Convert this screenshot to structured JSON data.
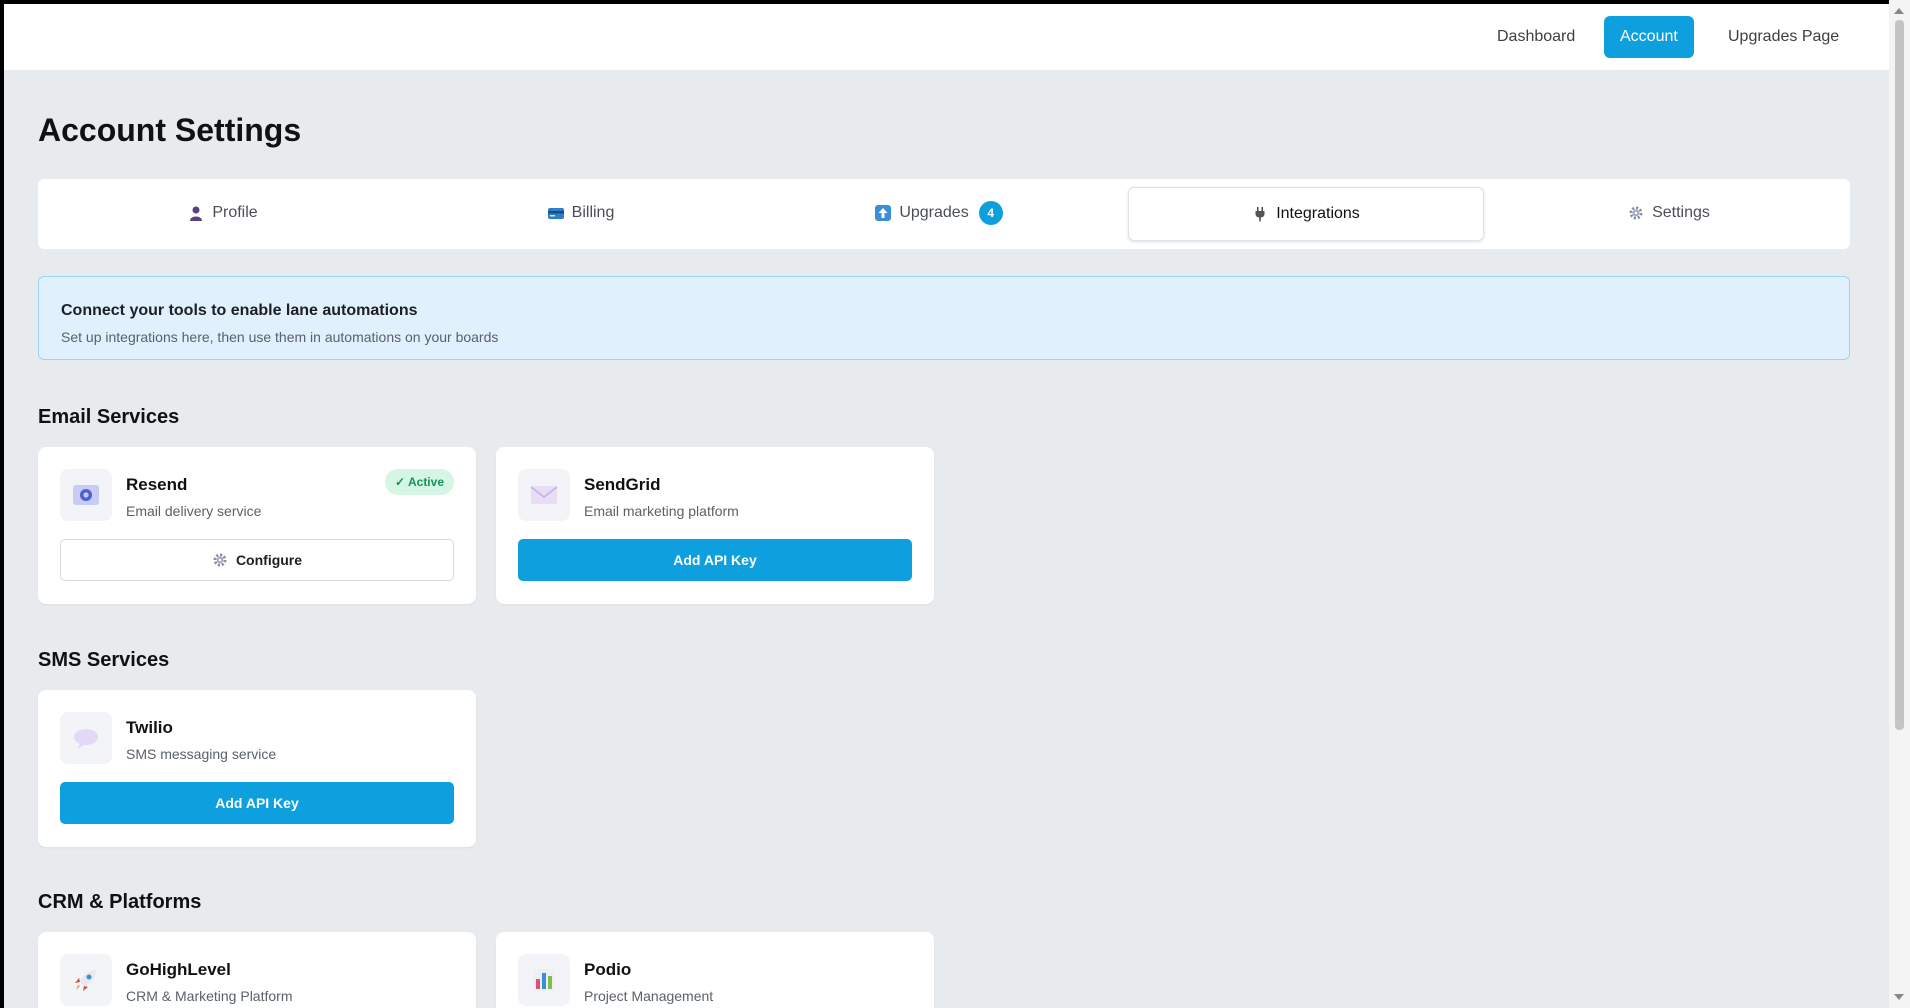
{
  "topnav": {
    "links": [
      {
        "label": "Dashboard"
      },
      {
        "label": "Account"
      },
      {
        "label": "Upgrades Page"
      }
    ]
  },
  "page": {
    "title": "Account Settings"
  },
  "tabs": [
    {
      "label": "Profile",
      "icon": "person-icon"
    },
    {
      "label": "Billing",
      "icon": "credit-card-icon"
    },
    {
      "label": "Upgrades",
      "icon": "up-arrow-icon",
      "badge": "4"
    },
    {
      "label": "Integrations",
      "icon": "plug-icon"
    },
    {
      "label": "Settings",
      "icon": "gear-icon"
    }
  ],
  "info": {
    "title": "Connect your tools to enable lane automations",
    "subtitle": "Set up integrations here, then use them in automations on your boards"
  },
  "sections": {
    "email": {
      "title": "Email Services",
      "cards": [
        {
          "name": "Resend",
          "desc": "Email delivery service",
          "status": "✓ Active",
          "button": "Configure",
          "icon": "mail-icon"
        },
        {
          "name": "SendGrid",
          "desc": "Email marketing platform",
          "button": "Add API Key",
          "icon": "envelope-icon"
        }
      ]
    },
    "sms": {
      "title": "SMS Services",
      "cards": [
        {
          "name": "Twilio",
          "desc": "SMS messaging service",
          "button": "Add API Key",
          "icon": "speech-bubble-icon"
        }
      ]
    },
    "crm": {
      "title": "CRM & Platforms",
      "cards": [
        {
          "name": "GoHighLevel",
          "desc": "CRM & Marketing Platform",
          "icon": "rocket-icon"
        },
        {
          "name": "Podio",
          "desc": "Project Management",
          "icon": "bar-chart-icon"
        }
      ]
    }
  },
  "colors": {
    "accent": "#0ea0de",
    "background": "#e8ebee",
    "active_badge_bg": "#d5f6e4",
    "active_badge_text": "#16935a",
    "info_bg": "#e0f0fc"
  }
}
